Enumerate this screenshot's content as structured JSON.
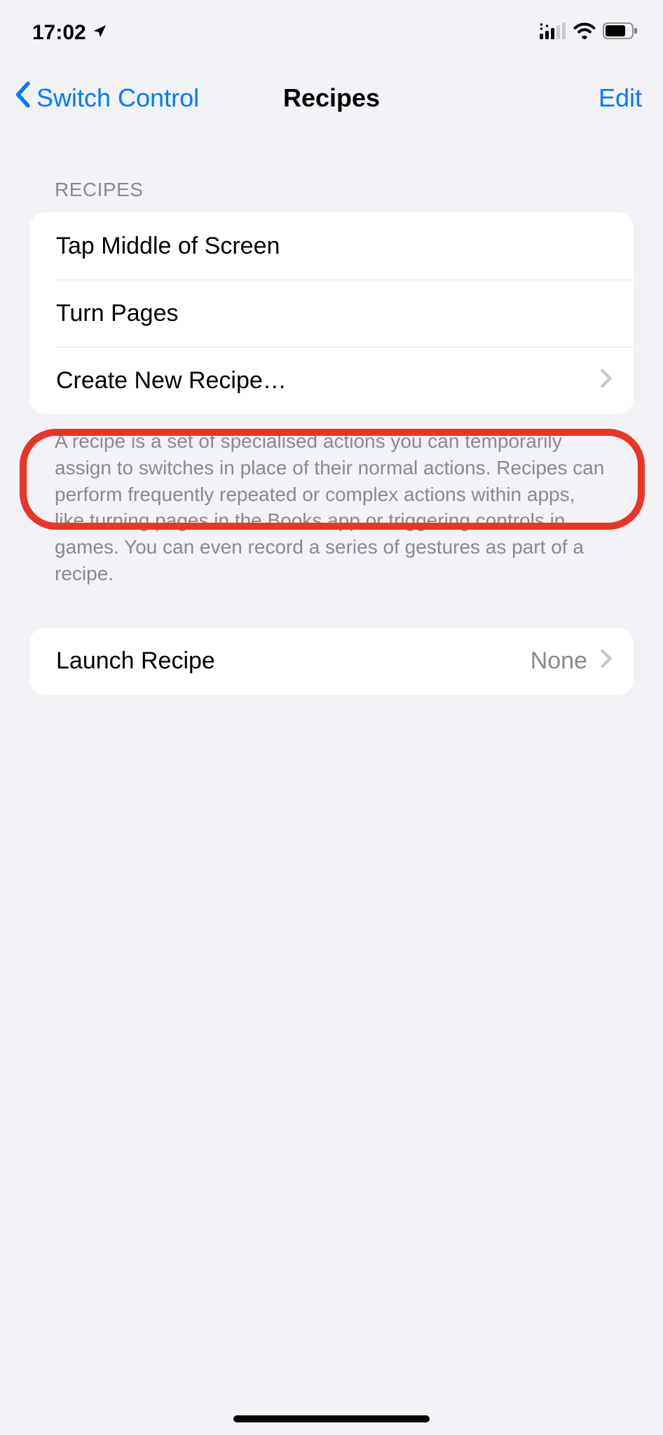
{
  "status_bar": {
    "time": "17:02"
  },
  "nav": {
    "back_label": "Switch Control",
    "title": "Recipes",
    "edit_label": "Edit"
  },
  "sections": {
    "recipes": {
      "header": "RECIPES",
      "items": [
        {
          "label": "Tap Middle of Screen"
        },
        {
          "label": "Turn Pages"
        },
        {
          "label": "Create New Recipe…"
        }
      ],
      "footer": "A recipe is a set of specialised actions you can temporarily assign to switches in place of their normal actions. Recipes can perform frequently repeated or complex actions within apps, like turning pages in the Books app or triggering controls in games. You can even record a series of gestures as part of a recipe."
    },
    "launch": {
      "label": "Launch Recipe",
      "value": "None"
    }
  }
}
